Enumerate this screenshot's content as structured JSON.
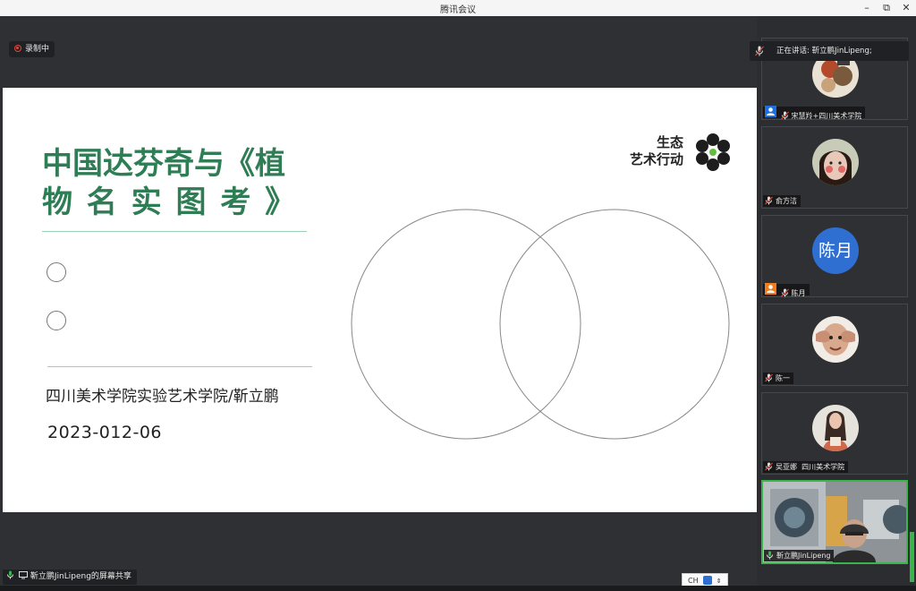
{
  "window": {
    "title": "腾讯会议"
  },
  "recording": {
    "label": "录制中"
  },
  "speaking": {
    "label": "正在讲话:",
    "speaker": "靳立鹏JinLipeng;"
  },
  "slide": {
    "title_line1": "中国达芬奇与《植",
    "title_line2": "物 名 实 图 考 》",
    "subtitle": "四川美术学院实验艺术学院/靳立鹏",
    "date": "2023-012-06",
    "brand_line1": "生态",
    "brand_line2": "艺术行动"
  },
  "participants": [
    {
      "name": "宋慧羚+四川美术学院",
      "avatar": "illustration-avatar",
      "host_icon": "host-person-icon",
      "host_color": "#1e6fe0"
    },
    {
      "name": "俞方洁",
      "avatar": "portrait-painting-avatar"
    },
    {
      "name": "陈月",
      "avatar_text": "陈月",
      "avatar_color": "#2f6fd1",
      "host_icon": "cohost-person-icon",
      "host_color": "#f07c1e"
    },
    {
      "name": "陈一",
      "avatar": "hands-face-avatar"
    },
    {
      "name": "吴亚娜  四川美术学院",
      "avatar": "woman-photo-avatar"
    },
    {
      "name": "靳立鹏JinLipeng",
      "avatar": "video-feed",
      "active": true
    }
  ],
  "share": {
    "label": "靳立鹏JinLipeng的屏幕共享"
  },
  "ime": {
    "label": "CH"
  },
  "colors": {
    "title_green": "#2e7d55",
    "active_border": "#39b54a",
    "stage_bg": "#2e3033"
  }
}
